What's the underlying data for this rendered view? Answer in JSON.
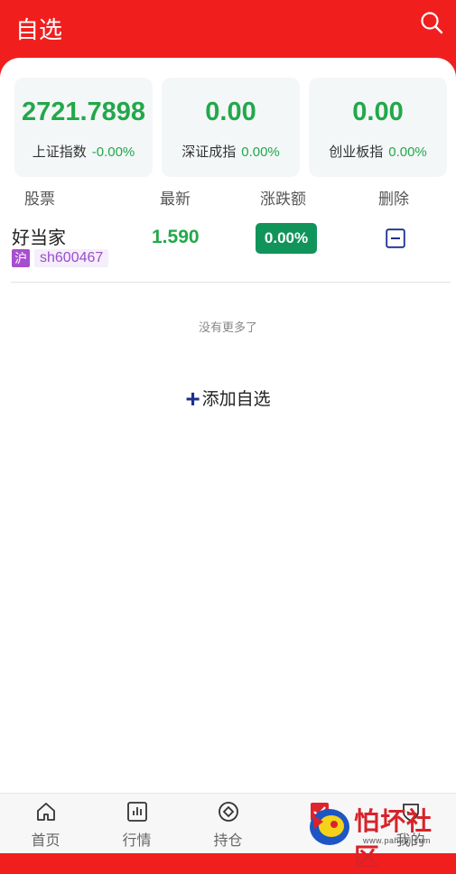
{
  "header": {
    "title": "自选",
    "search_icon": "search-icon"
  },
  "indices": [
    {
      "value": "2721.7898",
      "name": "上证指数",
      "change": "-0.00%"
    },
    {
      "value": "0.00",
      "name": "深证成指",
      "change": "0.00%"
    },
    {
      "value": "0.00",
      "name": "创业板指",
      "change": "0.00%"
    }
  ],
  "table": {
    "columns": [
      "股票",
      "最新",
      "涨跌额",
      "删除"
    ],
    "rows": [
      {
        "name": "好当家",
        "market": "沪",
        "code": "sh600467",
        "price": "1.590",
        "change": "0.00%"
      }
    ]
  },
  "no_more_text": "没有更多了",
  "add_button_label": "添加自选",
  "tabbar": [
    {
      "label": "首页",
      "icon": "home-icon"
    },
    {
      "label": "行情",
      "icon": "chart-icon"
    },
    {
      "label": "持仓",
      "icon": "position-icon"
    },
    {
      "label": "",
      "icon": "watchlist-icon"
    },
    {
      "label": "我的",
      "icon": "profile-icon"
    }
  ],
  "watermark": {
    "text": "怕坏社区",
    "url": "www.pahuai.com"
  },
  "colors": {
    "brand_red": "#f11e1e",
    "up_green": "#22a84a",
    "badge_green": "#10945a",
    "market_purple": "#a64fcf",
    "accent_blue": "#1b2f8e"
  }
}
